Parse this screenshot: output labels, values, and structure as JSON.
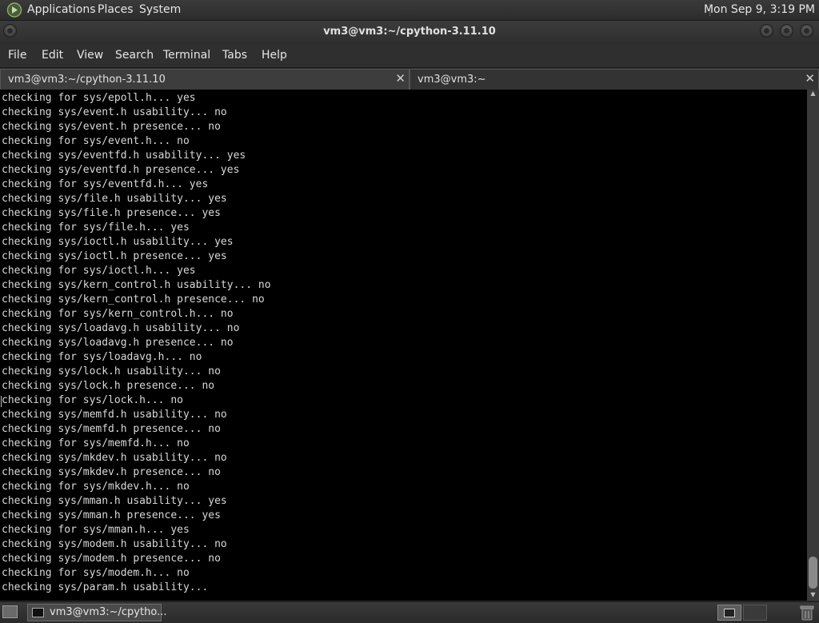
{
  "top_panel": {
    "applications": "Applications",
    "places": "Places",
    "system": "System",
    "clock": "Mon Sep  9,  3:19 PM"
  },
  "window": {
    "title": "vm3@vm3:~/cpython-3.11.10"
  },
  "menubar": {
    "file": "File",
    "edit": "Edit",
    "view": "View",
    "search": "Search",
    "terminal": "Terminal",
    "tabs": "Tabs",
    "help": "Help"
  },
  "tabs": [
    {
      "label": "vm3@vm3:~/cpython-3.11.10",
      "close": "✕"
    },
    {
      "label": "vm3@vm3:~",
      "close": "✕"
    }
  ],
  "terminal": {
    "lines": [
      "checking for sys/epoll.h... yes",
      "checking sys/event.h usability... no",
      "checking sys/event.h presence... no",
      "checking for sys/event.h... no",
      "checking sys/eventfd.h usability... yes",
      "checking sys/eventfd.h presence... yes",
      "checking for sys/eventfd.h... yes",
      "checking sys/file.h usability... yes",
      "checking sys/file.h presence... yes",
      "checking for sys/file.h... yes",
      "checking sys/ioctl.h usability... yes",
      "checking sys/ioctl.h presence... yes",
      "checking for sys/ioctl.h... yes",
      "checking sys/kern_control.h usability... no",
      "checking sys/kern_control.h presence... no",
      "checking for sys/kern_control.h... no",
      "checking sys/loadavg.h usability... no",
      "checking sys/loadavg.h presence... no",
      "checking for sys/loadavg.h... no",
      "checking sys/lock.h usability... no",
      "checking sys/lock.h presence... no",
      "checking for sys/lock.h... no",
      "checking sys/memfd.h usability... no",
      "checking sys/memfd.h presence... no",
      "checking for sys/memfd.h... no",
      "checking sys/mkdev.h usability... no",
      "checking sys/mkdev.h presence... no",
      "checking for sys/mkdev.h... no",
      "checking sys/mman.h usability... yes",
      "checking sys/mman.h presence... yes",
      "checking for sys/mman.h... yes",
      "checking sys/modem.h usability... no",
      "checking sys/modem.h presence... no",
      "checking for sys/modem.h... no",
      "checking sys/param.h usability..."
    ]
  },
  "taskbar": {
    "item_label": "vm3@vm3:~/cpytho..."
  },
  "icons": {
    "app_logo": "app-logo-icon",
    "show_desktop": "show-desktop-icon",
    "terminal": "terminal-icon",
    "trash": "trash-icon"
  },
  "colors": {
    "terminal_bg": "#000000",
    "terminal_fg": "#d8d8d8",
    "chrome": "#2f2f2f"
  }
}
